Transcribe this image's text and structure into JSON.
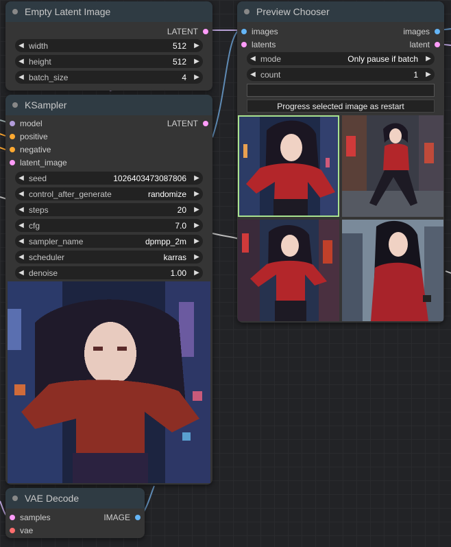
{
  "nodes": {
    "empty_latent": {
      "title": "Empty Latent Image",
      "output_label": "LATENT",
      "widgets": [
        {
          "label": "width",
          "value": "512"
        },
        {
          "label": "height",
          "value": "512"
        },
        {
          "label": "batch_size",
          "value": "4"
        }
      ]
    },
    "ksampler": {
      "title": "KSampler",
      "inputs": [
        "model",
        "positive",
        "negative",
        "latent_image"
      ],
      "output_label": "LATENT",
      "widgets": [
        {
          "label": "seed",
          "value": "1026403473087806"
        },
        {
          "label": "control_after_generate",
          "value": "randomize"
        },
        {
          "label": "steps",
          "value": "20"
        },
        {
          "label": "cfg",
          "value": "7.0"
        },
        {
          "label": "sampler_name",
          "value": "dpmpp_2m"
        },
        {
          "label": "scheduler",
          "value": "karras"
        },
        {
          "label": "denoise",
          "value": "1.00"
        }
      ]
    },
    "preview_chooser": {
      "title": "Preview Chooser",
      "inputs": [
        "images",
        "latents"
      ],
      "outputs": [
        "images",
        "latent"
      ],
      "widgets": [
        {
          "label": "mode",
          "value": "Only pause if batch"
        },
        {
          "label": "count",
          "value": "1"
        }
      ],
      "button_label": "Progress selected image as restart"
    },
    "vae_decode": {
      "title": "VAE Decode",
      "inputs": [
        "samples",
        "vae"
      ],
      "output_label": "IMAGE"
    }
  },
  "icons": {
    "arrow_left": "◀",
    "arrow_right": "▶"
  },
  "colors": {
    "latent": "#ff9cf9",
    "model": "#b39ddb",
    "conditioning": "#ffa931",
    "image": "#64b5f6",
    "vae": "#ff6e6e",
    "selected": "#a9e38f"
  }
}
